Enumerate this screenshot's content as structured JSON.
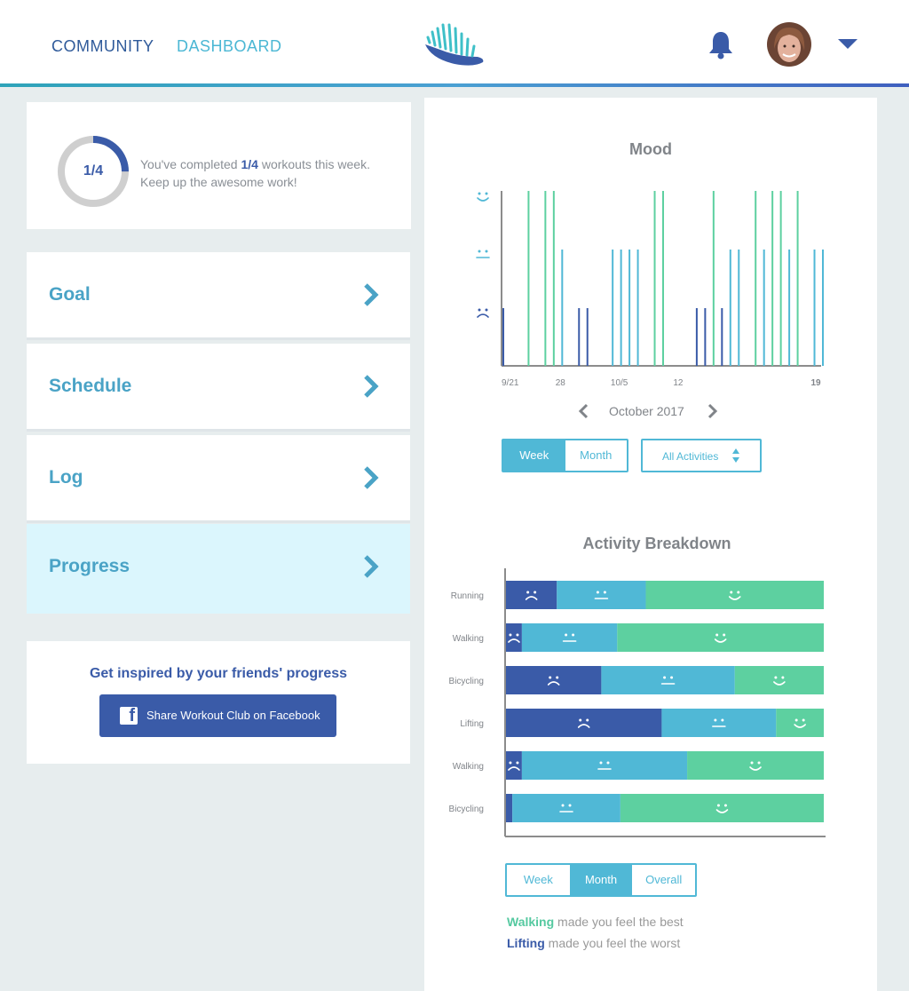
{
  "nav": {
    "community": "COMMUNITY",
    "dashboard": "DASHBOARD"
  },
  "colors": {
    "dark_blue": "#3a5ba8",
    "light_blue": "#50b8d6",
    "green": "#5dd0a0",
    "progress_bg": "#dbf6fd"
  },
  "icons": {
    "logo": "shoe-logo-icon",
    "notifications": "bell-icon",
    "menu": "caret-down-icon",
    "facebook": "facebook-icon"
  },
  "progress": {
    "ring_label": "1/4",
    "completed_fraction": 0.25,
    "text_prefix": "You've completed ",
    "text_bold": "1/4",
    "text_suffix": " workouts this week.",
    "text_line2": "Keep up the awesome work!"
  },
  "menu": [
    {
      "label": "Goal"
    },
    {
      "label": "Schedule"
    },
    {
      "label": "Log"
    },
    {
      "label": "Progress"
    }
  ],
  "share": {
    "title": "Get inspired by your friends' progress",
    "button": "Share Workout Club on Facebook"
  },
  "mood": {
    "title": "Mood",
    "month_label": "October 2017",
    "toggle": [
      "Week",
      "Month"
    ],
    "toggle_active": "Week",
    "filter": "All Activities"
  },
  "activity": {
    "title": "Activity Breakdown",
    "toggle": [
      "Week",
      "Month",
      "Overall"
    ],
    "toggle_active": "Month",
    "best_activity": "Walking",
    "best_text": " made you feel the best",
    "worst_activity": "Lifting",
    "worst_text": " made you feel the worst"
  },
  "chart_data": [
    {
      "type": "bar",
      "title": "Mood",
      "x_tick_labels": [
        "9/21",
        "28",
        "10/5",
        "12",
        "19"
      ],
      "y_levels": [
        "sad",
        "neutral",
        "happy"
      ],
      "mood_by_day": [
        1,
        0,
        0,
        3,
        0,
        3,
        3,
        2,
        0,
        1,
        1,
        0,
        0,
        2,
        2,
        2,
        2,
        0,
        3,
        3,
        0,
        0,
        0,
        1,
        1,
        3,
        1,
        2,
        2,
        0,
        3,
        2,
        3,
        3,
        2,
        3,
        0,
        2,
        2
      ],
      "mood_scale": {
        "0": "none",
        "1": "sad",
        "2": "neutral",
        "3": "happy"
      }
    },
    {
      "type": "bar",
      "title": "Activity Breakdown",
      "categories": [
        "Running",
        "Walking",
        "Bicycling",
        "Lifting",
        "Walking",
        "Bicycling"
      ],
      "stacked": true,
      "series": [
        {
          "mood": "sad",
          "values": [
            16,
            5,
            30,
            49,
            5,
            2
          ]
        },
        {
          "mood": "neutral",
          "values": [
            28,
            30,
            42,
            36,
            52,
            34
          ]
        },
        {
          "mood": "happy",
          "values": [
            56,
            65,
            28,
            15,
            43,
            64
          ]
        }
      ]
    }
  ]
}
